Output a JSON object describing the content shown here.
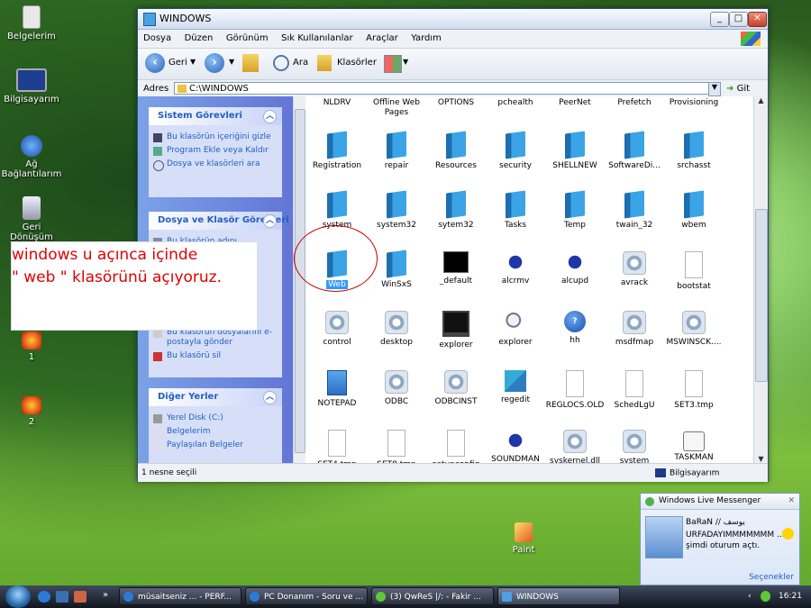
{
  "desktop": {
    "icons": [
      {
        "label": "Belgelerim"
      },
      {
        "label": "Bilgisayarım"
      },
      {
        "label": "Ağ Bağlantılarım"
      },
      {
        "label": "Geri Dönüşüm Kutusu"
      },
      {
        "label": "1"
      },
      {
        "label": "2"
      },
      {
        "label": "Paint"
      }
    ]
  },
  "window": {
    "title": "WINDOWS",
    "controls": {
      "min": "_",
      "max": "□",
      "close": "✕"
    },
    "menu": [
      "Dosya",
      "Düzen",
      "Görünüm",
      "Sık Kullanılanlar",
      "Araçlar",
      "Yardım"
    ],
    "toolbar": {
      "back": "Geri",
      "search": "Ara",
      "folders": "Klasörler"
    },
    "address": {
      "label": "Adres",
      "value": "C:\\WINDOWS",
      "go": "Git"
    },
    "left_panels": {
      "system_tasks": {
        "title": "Sistem Görevleri",
        "items": [
          "Bu klasörün içeriğini gizle",
          "Program Ekle veya Kaldır",
          "Dosya ve klasörleri ara"
        ]
      },
      "file_tasks": {
        "title": "Dosya ve Klasör Görevleri",
        "items": [
          "Bu klasörün adını",
          "Bu klasörün dosyalarını e-postayla gönder",
          "Bu klasörü sil"
        ]
      },
      "other_places": {
        "title": "Diğer Yerler",
        "items": [
          "Yerel Disk (C:)",
          "Belgelerim",
          "Paylaşılan Belgeler"
        ]
      }
    },
    "files": [
      {
        "name": "NLDRV",
        "type": "label"
      },
      {
        "name": "Offline Web Pages",
        "type": "label"
      },
      {
        "name": "OPTIONS",
        "type": "label"
      },
      {
        "name": "pchealth",
        "type": "label"
      },
      {
        "name": "PeerNet",
        "type": "label"
      },
      {
        "name": "Prefetch",
        "type": "label"
      },
      {
        "name": "Provisioning",
        "type": "label"
      },
      {
        "name": "Registration",
        "type": "folder"
      },
      {
        "name": "repair",
        "type": "folder"
      },
      {
        "name": "Resources",
        "type": "folder"
      },
      {
        "name": "security",
        "type": "folder"
      },
      {
        "name": "SHELLNEW",
        "type": "folder"
      },
      {
        "name": "SoftwareDi...",
        "type": "folder"
      },
      {
        "name": "srchasst",
        "type": "folder"
      },
      {
        "name": "system",
        "type": "folder"
      },
      {
        "name": "system32",
        "type": "folder"
      },
      {
        "name": "sytem32",
        "type": "folder"
      },
      {
        "name": "Tasks",
        "type": "folder"
      },
      {
        "name": "Temp",
        "type": "folder"
      },
      {
        "name": "twain_32",
        "type": "folder"
      },
      {
        "name": "wbem",
        "type": "folder"
      },
      {
        "name": "Web",
        "type": "folder"
      },
      {
        "name": "WinSxS",
        "type": "folder"
      },
      {
        "name": "_default",
        "type": "blackwin"
      },
      {
        "name": "alcrmv",
        "type": "bug"
      },
      {
        "name": "alcupd",
        "type": "bug"
      },
      {
        "name": "avrack",
        "type": "gear"
      },
      {
        "name": "bootstat",
        "type": "file"
      },
      {
        "name": "control",
        "type": "gear"
      },
      {
        "name": "desktop",
        "type": "gear"
      },
      {
        "name": "explorer",
        "type": "screen"
      },
      {
        "name": "explorer",
        "type": "mag"
      },
      {
        "name": "hh",
        "type": "help"
      },
      {
        "name": "msdfmap",
        "type": "gear"
      },
      {
        "name": "MSWINSCK....",
        "type": "gear"
      },
      {
        "name": "NOTEPAD",
        "type": "notepad"
      },
      {
        "name": "ODBC",
        "type": "gear"
      },
      {
        "name": "ODBCINST",
        "type": "gear"
      },
      {
        "name": "regedit",
        "type": "cubes"
      },
      {
        "name": "REGLOCS.OLD",
        "type": "file"
      },
      {
        "name": "SchedLgU",
        "type": "file"
      },
      {
        "name": "SET3.tmp",
        "type": "file"
      },
      {
        "name": "SET4.tmp",
        "type": "file"
      },
      {
        "name": "SET8.tmp",
        "type": "file"
      },
      {
        "name": "setupconfig",
        "type": "file"
      },
      {
        "name": "SOUNDMAN",
        "type": "bug"
      },
      {
        "name": "syskernel.dll",
        "type": "gear"
      },
      {
        "name": "system",
        "type": "gear"
      },
      {
        "name": "TASKMAN",
        "type": "task"
      }
    ],
    "selected_item": "Web",
    "status": {
      "left": "1 nesne seçili",
      "right": "Bilgisayarım"
    }
  },
  "annotation": {
    "line1": "windows u açınca içinde",
    "line2": "\" web \" klasörünü açıyoruz."
  },
  "messenger": {
    "title": "Windows Live Messenger",
    "name": "BaRaN // يوسف",
    "status_line": "URFADAYIMMMMMMM ...",
    "action": "şimdi oturum açtı.",
    "options": "Seçenekler"
  },
  "taskbar": {
    "tasks": [
      {
        "label": "müsaitseniz ... - PERF..."
      },
      {
        "label": "PC Donanım - Soru ve ..."
      },
      {
        "label": "(3) QwReS |/: - Fakir ..."
      },
      {
        "label": "WINDOWS"
      }
    ],
    "clock": "16:21"
  },
  "colors": {
    "accent": "#215dc6",
    "annotation_red": "#e00000",
    "selection": "#3399ff"
  }
}
